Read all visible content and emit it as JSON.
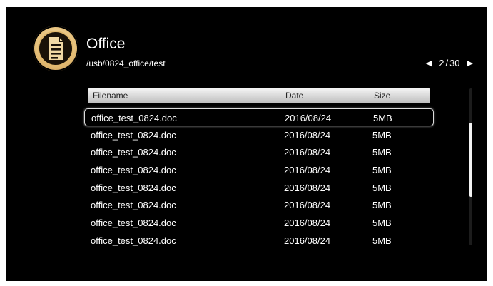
{
  "app": {
    "title": "Office",
    "path": "/usb/0824_office/test",
    "icon": "document-icon",
    "accent": "#e2b96e"
  },
  "pager": {
    "current": "2",
    "separator": "/",
    "total": "30",
    "prev_icon": "triangle-left-icon",
    "next_icon": "triangle-right-icon"
  },
  "columns": {
    "filename": "Filename",
    "date": "Date",
    "size": "Size"
  },
  "files": [
    {
      "name": "office_test_0824.doc",
      "date": "2016/08/24",
      "size": "5MB",
      "selected": true
    },
    {
      "name": "office_test_0824.doc",
      "date": "2016/08/24",
      "size": "5MB"
    },
    {
      "name": "office_test_0824.doc",
      "date": "2016/08/24",
      "size": "5MB"
    },
    {
      "name": "office_test_0824.doc",
      "date": "2016/08/24",
      "size": "5MB"
    },
    {
      "name": "office_test_0824.doc",
      "date": "2016/08/24",
      "size": "5MB"
    },
    {
      "name": "office_test_0824.doc",
      "date": "2016/08/24",
      "size": "5MB"
    },
    {
      "name": "office_test_0824.doc",
      "date": "2016/08/24",
      "size": "5MB"
    },
    {
      "name": "office_test_0824.doc",
      "date": "2016/08/24",
      "size": "5MB"
    }
  ]
}
